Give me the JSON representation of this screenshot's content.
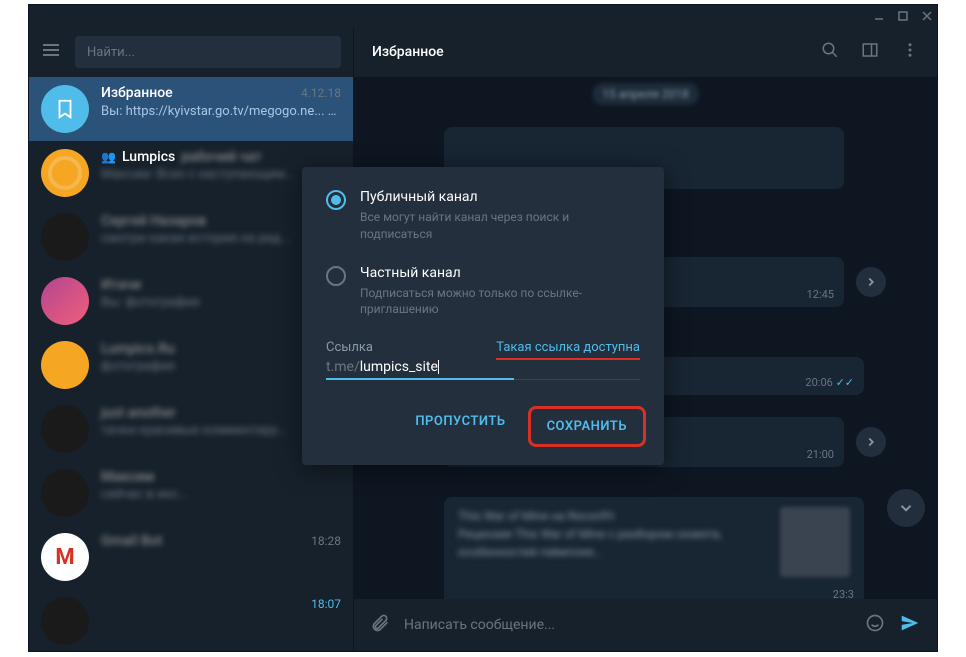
{
  "search": {
    "placeholder": "Найти..."
  },
  "header": {
    "title": "Избранное"
  },
  "chats": [
    {
      "name": "Избранное",
      "date": "4.12.18",
      "preview": "Вы: https://kyivstar.go.tv/megogo.ne..."
    },
    {
      "name": "Lumpics",
      "suffix": "рабочий чат",
      "date": "",
      "preview": "Максим: Всех с наступающим..."
    },
    {
      "name": "Сергей Назаров",
      "date": "",
      "preview": "смотри какая история на ред..."
    },
    {
      "name": "Итачи",
      "date": "",
      "preview": "Вы: фотография"
    },
    {
      "name": "Lumpics.Ru",
      "date": "",
      "preview": "фотография"
    },
    {
      "name": "just another",
      "date": "",
      "preview": "тачки красивые комментиру..."
    },
    {
      "name": "Максим",
      "date": "",
      "preview": "сейчас в икс..."
    },
    {
      "name": "Gmail Bot",
      "date": "18:28",
      "preview": ""
    },
    {
      "name": "",
      "date": "18:07",
      "preview": ""
    }
  ],
  "date_chip": "15 апреля 2018",
  "msg_times": {
    "m2": "12:45",
    "m3": "20:06",
    "m4": "21:00",
    "m5": "23:3"
  },
  "modal": {
    "option_public_title": "Публичный канал",
    "option_public_desc": "Все могут найти канал через поиск и подписаться",
    "option_private_title": "Частный канал",
    "option_private_desc": "Подписаться можно только по ссылке-приглашению",
    "link_label": "Ссылка",
    "link_status": "Такая ссылка доступна",
    "link_prefix": "t.me/",
    "link_value": "lumpics_site",
    "btn_skip": "ПРОПУСТИТЬ",
    "btn_save": "СОХРАНИТЬ"
  },
  "composer": {
    "placeholder": "Написать сообщение..."
  }
}
